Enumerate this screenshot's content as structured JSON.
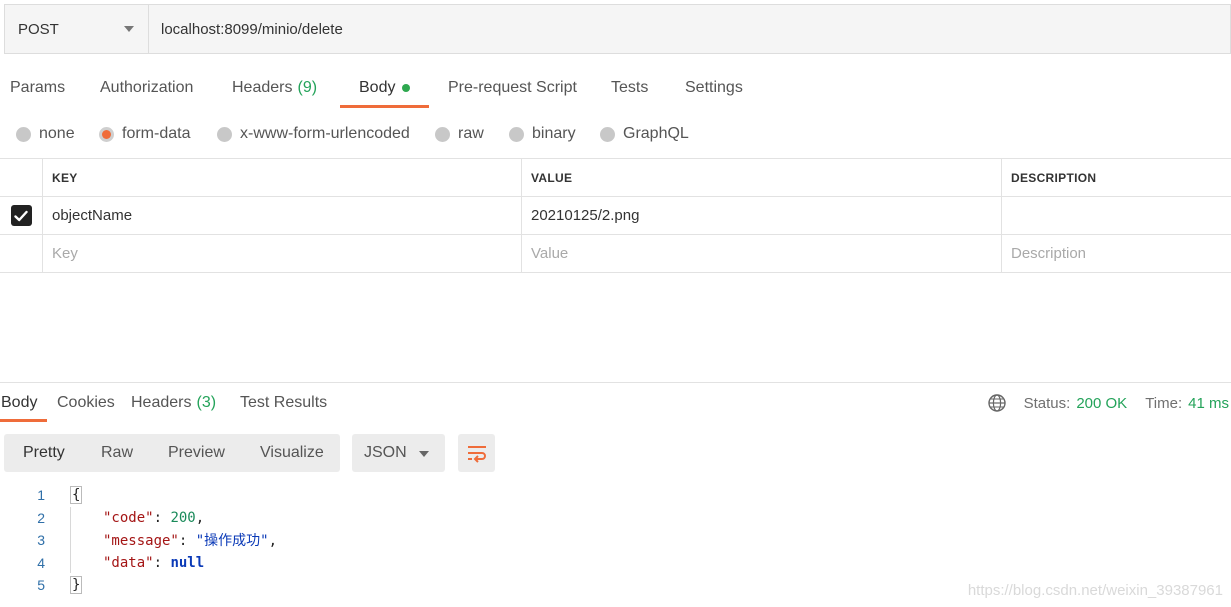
{
  "request": {
    "method": "POST",
    "url": "localhost:8099/minio/delete"
  },
  "request_tabs": [
    {
      "label": "Params"
    },
    {
      "label": "Authorization"
    },
    {
      "label": "Headers",
      "count": "(9)"
    },
    {
      "label": "Body"
    },
    {
      "label": "Pre-request Script"
    },
    {
      "label": "Tests"
    },
    {
      "label": "Settings"
    }
  ],
  "body_types": [
    {
      "label": "none"
    },
    {
      "label": "form-data"
    },
    {
      "label": "x-www-form-urlencoded"
    },
    {
      "label": "raw"
    },
    {
      "label": "binary"
    },
    {
      "label": "GraphQL"
    }
  ],
  "params_table": {
    "headers": {
      "key": "KEY",
      "value": "VALUE",
      "description": "DESCRIPTION"
    },
    "rows": [
      {
        "key": "objectName",
        "value": "20210125/2.png",
        "description": "",
        "checked": true
      }
    ],
    "placeholder": {
      "key": "Key",
      "value": "Value",
      "description": "Description"
    }
  },
  "response_tabs": [
    {
      "label": "Body"
    },
    {
      "label": "Cookies"
    },
    {
      "label": "Headers",
      "count": "(3)"
    },
    {
      "label": "Test Results"
    }
  ],
  "response_status": {
    "status_label": "Status:",
    "status_value": "200 OK",
    "time_label": "Time:",
    "time_value": "41 ms"
  },
  "format_tabs": [
    {
      "label": "Pretty"
    },
    {
      "label": "Raw"
    },
    {
      "label": "Preview"
    },
    {
      "label": "Visualize"
    }
  ],
  "language_select": "JSON",
  "code_lines": {
    "numbers": [
      "1",
      "2",
      "3",
      "4",
      "5"
    ],
    "open_brace": "{",
    "close_brace": "}",
    "key_code": "\"code\"",
    "val_code": "200",
    "key_message": "\"message\"",
    "val_message": "\"操作成功\"",
    "key_data": "\"data\"",
    "val_data": "null"
  },
  "watermark": "https://blog.csdn.net/weixin_39387961",
  "colors": {
    "accent": "#ef6c3a",
    "success": "#24a35a"
  },
  "icons": [
    "chevron-down-icon",
    "checkbox-checked-icon",
    "globe-icon",
    "wrap-lines-icon"
  ]
}
